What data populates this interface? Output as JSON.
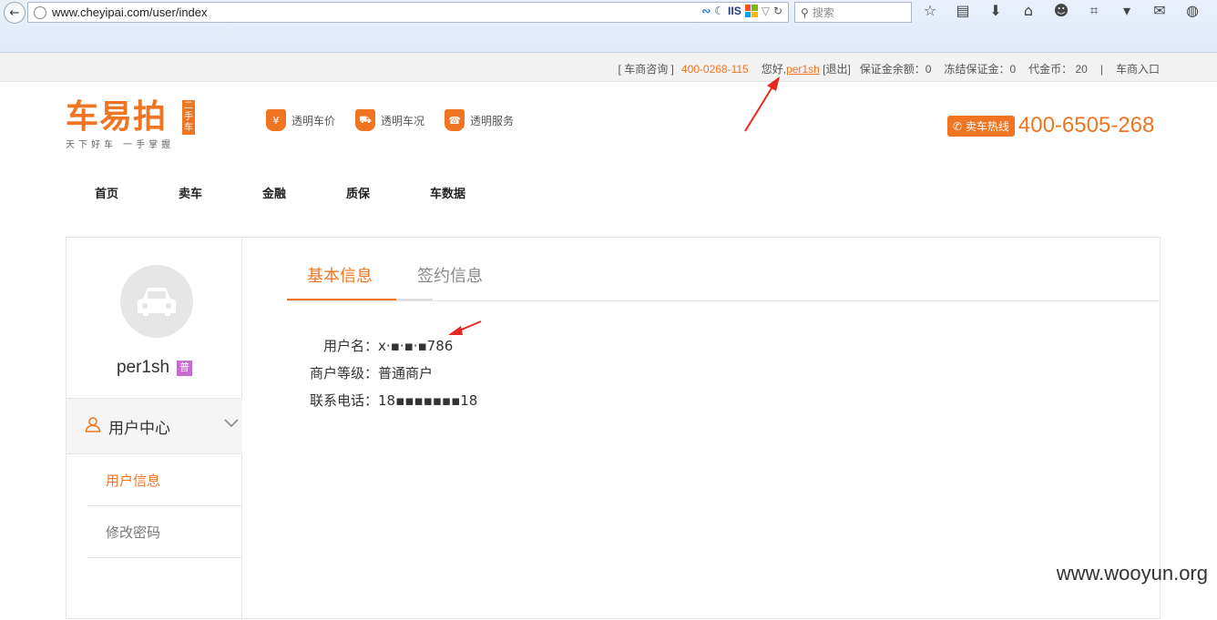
{
  "browser": {
    "url": "www.cheyipai.com/user/index",
    "search_placeholder": "搜索",
    "iis_label": "IIS"
  },
  "topbar": {
    "dealer_consult_label": "[ 车商咨询 ]",
    "dealer_phone": "400-0268-115",
    "greeting": "您好,",
    "username": "per1sh",
    "logout": "[退出]",
    "deposit_balance": "保证金余额：0",
    "frozen_deposit": "冻结保证金：0",
    "coupon": "代金币： 20",
    "separator": "|",
    "dealer_entry": "车商入口"
  },
  "header": {
    "logo_text": "车易拍",
    "logo_badge": "二手车",
    "logo_slogan": "天下好车 一手掌握",
    "features": [
      {
        "icon": "price-tag-icon",
        "glyph": "¥",
        "label": "透明车价"
      },
      {
        "icon": "car-condition-icon",
        "glyph": "⛟",
        "label": "透明车况"
      },
      {
        "icon": "service-icon",
        "glyph": "☎",
        "label": "透明服务"
      }
    ],
    "hotline_label": "卖车热线",
    "hotline_number": "400-6505-268"
  },
  "nav": [
    "首页",
    "卖车",
    "金融",
    "质保",
    "车数据"
  ],
  "profile": {
    "username": "per1sh",
    "level_badge": "普",
    "center_label": "用户中心",
    "menu": [
      "用户信息",
      "修改密码"
    ]
  },
  "tabs": [
    "基本信息",
    "签约信息"
  ],
  "info": {
    "rows": [
      {
        "label": "用户名：",
        "value": "x·▪·▪·▪786"
      },
      {
        "label": "商户等级：",
        "value": "普通商户"
      },
      {
        "label": "联系电话：",
        "value": "18▪▪▪▪▪▪▪18"
      }
    ]
  },
  "watermark": "www.wooyun.org",
  "colors": {
    "accent": "#f07522",
    "badge": "#c66ccf",
    "arrow": "#e8281f"
  }
}
